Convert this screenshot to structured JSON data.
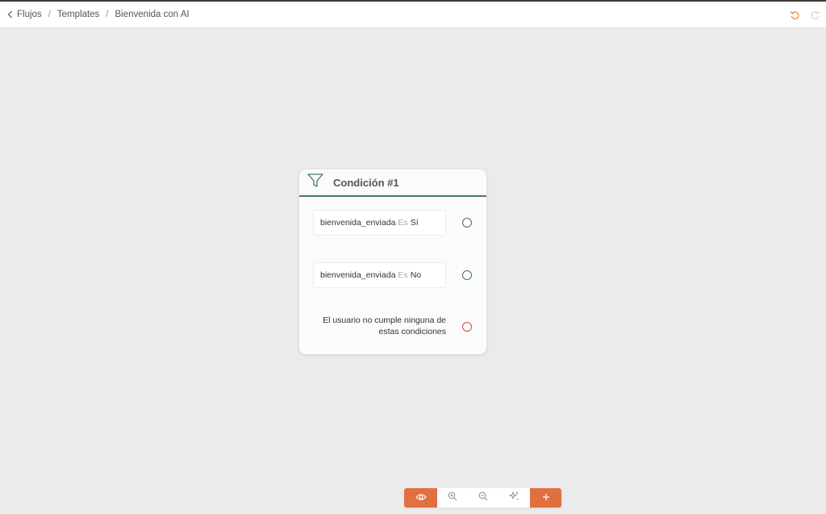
{
  "breadcrumb": {
    "items": [
      "Flujos",
      "Templates",
      "Bienvenida con AI"
    ],
    "separator": "/"
  },
  "header_actions": {
    "undo_icon": "undo-icon",
    "redo_icon": "redo-icon",
    "accent_color": "#e0883a"
  },
  "node": {
    "icon": "filter-icon",
    "title": "Condición #1",
    "accent_color": "#4d7c5b",
    "conditions": [
      {
        "variable": "bienvenida_enviada",
        "operator": "Es",
        "value": "Sí"
      },
      {
        "variable": "bienvenida_enviada",
        "operator": "Es",
        "value": "No"
      }
    ],
    "default_text": "El usuario no cumple ninguna de estas condiciones"
  },
  "toolbar": {
    "accent_color": "#e07040",
    "buttons": [
      "eye-icon",
      "zoom-in-icon",
      "zoom-out-icon",
      "sparkles-icon",
      "plus-icon"
    ]
  }
}
